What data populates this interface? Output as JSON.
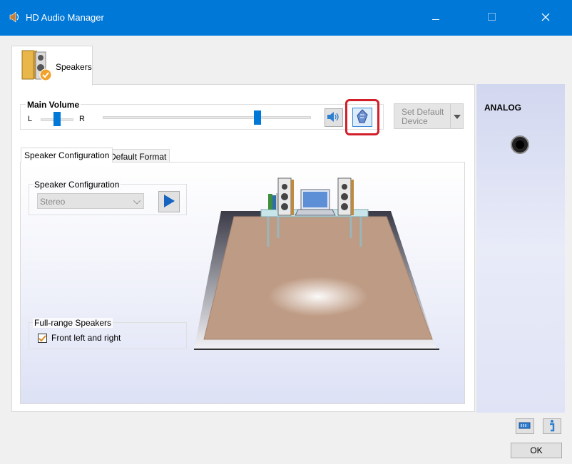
{
  "window": {
    "title": "HD Audio Manager",
    "controls": {
      "minimize": "minimize-icon",
      "maximize": "maximize-icon",
      "close": "close-icon"
    }
  },
  "device_tab": {
    "label": "Speakers",
    "icon": "speakers-icon"
  },
  "main_volume": {
    "title": "Main Volume",
    "balance_left_label": "L",
    "balance_right_label": "R",
    "balance_position": 0.5,
    "volume_level": 0.8,
    "mute_button_icon": "speaker-volume-icon",
    "highlighted_button_icon": "sound-effect-icon",
    "highlight_color": "#d21f2a"
  },
  "set_default": {
    "label_line1": "Set Default",
    "label_line2": "Device",
    "enabled": false
  },
  "sub_tabs": [
    {
      "label": "Speaker Configuration",
      "active": true
    },
    {
      "label": "Default Format",
      "active": false
    }
  ],
  "speaker_configuration": {
    "group_title": "Speaker Configuration",
    "selected": "Stereo",
    "test_button_icon": "play-icon"
  },
  "full_range": {
    "group_title": "Full-range Speakers",
    "option_label": "Front left and right",
    "checked": true
  },
  "analog_panel": {
    "title": "ANALOG",
    "jack_icon": "audio-jack-icon"
  },
  "footer": {
    "battery_icon": "power-icon",
    "info_icon": "info-icon",
    "ok_label": "OK"
  },
  "colors": {
    "titlebar": "#0078d7",
    "accent": "#0078d7"
  }
}
